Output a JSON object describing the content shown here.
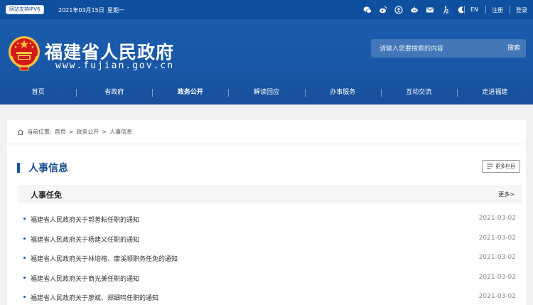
{
  "topbar": {
    "ipv6_badge": "网站支持IPV6",
    "date": "2021年03月15日",
    "weekday": "星期一",
    "icons": [
      "wechat-icon",
      "weibo-icon",
      "accessibility-icon",
      "robot-icon",
      "mail-icon",
      "elder-mode-icon",
      "moon-icon"
    ],
    "lang": "EN",
    "register": "注册",
    "login": "登录"
  },
  "header": {
    "site_title": "福建省人民政府",
    "site_url": "www.fujian.gov.cn",
    "search_placeholder": "请输入您要搜索的内容",
    "search_button": "搜索"
  },
  "nav": [
    {
      "label": "首页"
    },
    {
      "label": "省政府"
    },
    {
      "label": "政务公开"
    },
    {
      "label": "解读回应"
    },
    {
      "label": "办事服务"
    },
    {
      "label": "互动交流"
    },
    {
      "label": "走进福建"
    }
  ],
  "breadcrumb": {
    "prefix": "当前位置:",
    "items": [
      "首页",
      "政务公开",
      "人事信息"
    ],
    "sep": ">"
  },
  "section": {
    "title": "人事信息",
    "more_columns": "更多栏目"
  },
  "subsection": {
    "title": "人事任免",
    "more": "更多>"
  },
  "list": [
    {
      "title": "福建省人民政府关于郭善耘任职的通知",
      "date": "2021-03-02"
    },
    {
      "title": "福建省人民政府关于杨建义任职的通知",
      "date": "2021-03-02"
    },
    {
      "title": "福建省人民政府关于林培榕、康溪顺职务任免的通知",
      "date": "2021-03-02"
    },
    {
      "title": "福建省人民政府关于商光美任职的通知",
      "date": "2021-03-02"
    },
    {
      "title": "福建省人民政府关于廖斌、郑细鸣任职的通知",
      "date": "2021-03-02"
    }
  ],
  "colors": {
    "brand_blue": "#1a57a6",
    "topbar_blue": "#0f4f9f",
    "emblem_red": "#d21a1a",
    "emblem_gold": "#f5c242"
  }
}
